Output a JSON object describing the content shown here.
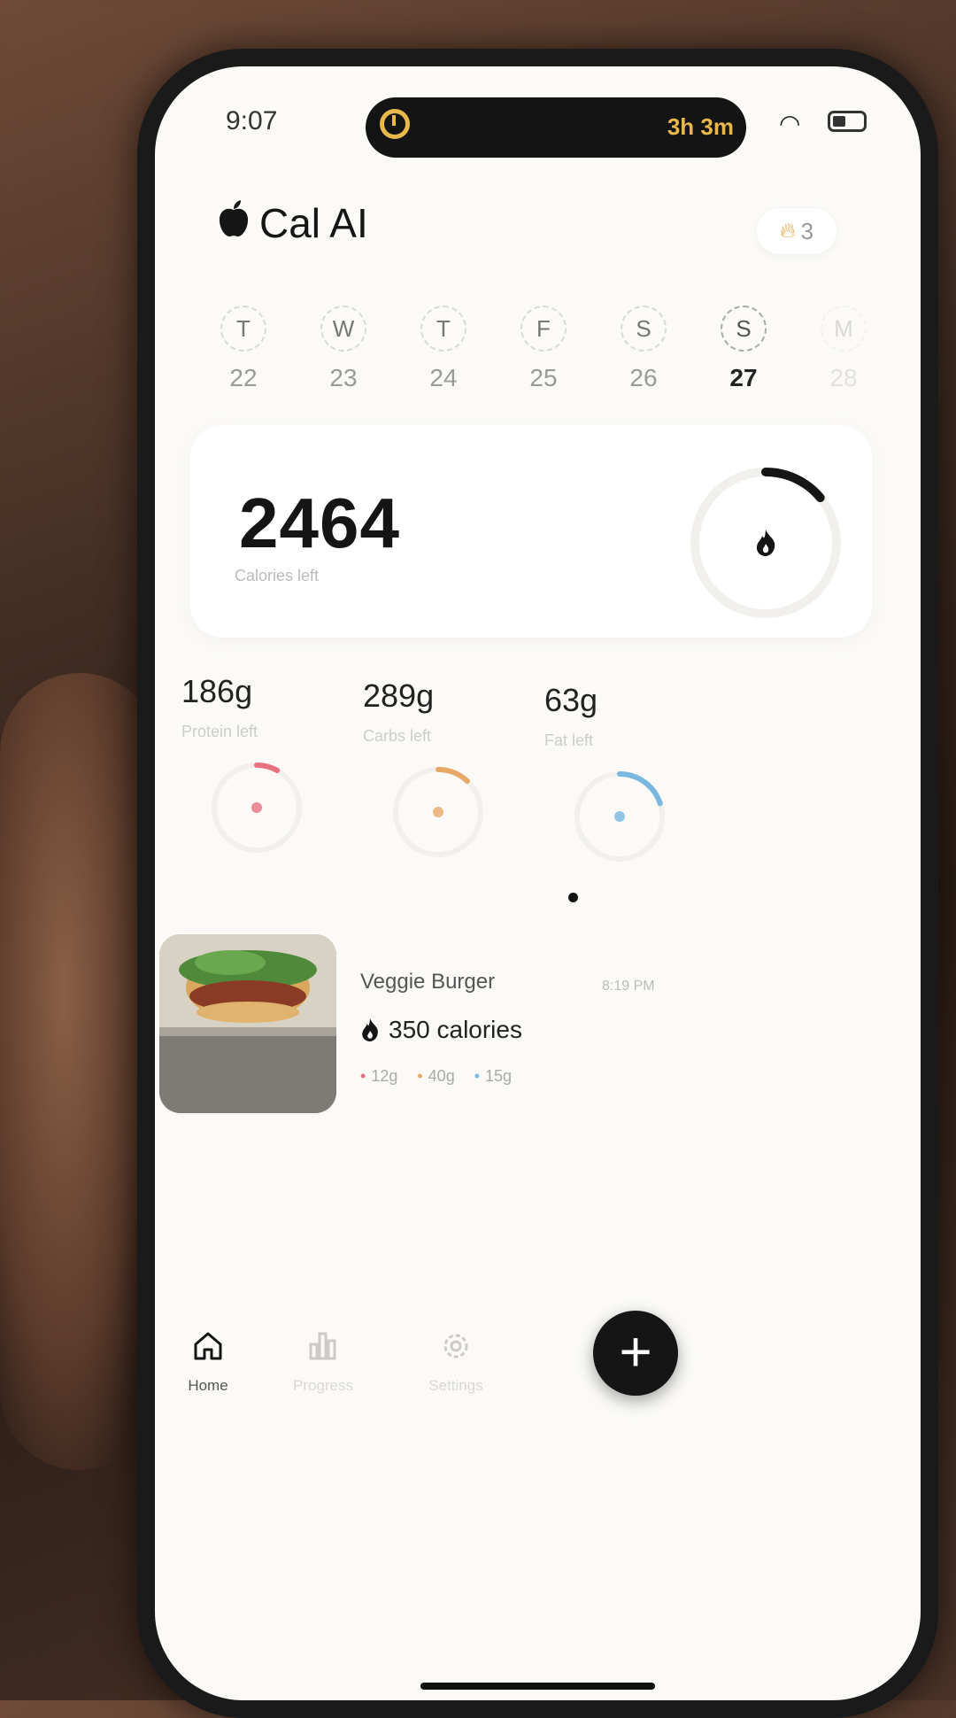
{
  "status_bar": {
    "time": "9:07",
    "island_timer": "3h 3m"
  },
  "header": {
    "app_title": "Cal AI",
    "streak_count": "3"
  },
  "week": [
    {
      "letter": "T",
      "num": "22",
      "state": "normal"
    },
    {
      "letter": "W",
      "num": "23",
      "state": "normal"
    },
    {
      "letter": "T",
      "num": "24",
      "state": "normal"
    },
    {
      "letter": "F",
      "num": "25",
      "state": "normal"
    },
    {
      "letter": "S",
      "num": "26",
      "state": "normal"
    },
    {
      "letter": "S",
      "num": "27",
      "state": "active"
    },
    {
      "letter": "M",
      "num": "28",
      "state": "faded"
    }
  ],
  "calories": {
    "value": "2464",
    "label": "Calories left",
    "progress": 0.14
  },
  "macros": [
    {
      "value": "186g",
      "label": "Protein left",
      "color": "#e8717f",
      "progress": 0.08
    },
    {
      "value": "289g",
      "label": "Carbs left",
      "color": "#e8a866",
      "progress": 0.12
    },
    {
      "value": "63g",
      "label": "Fat left",
      "color": "#7ab8e0",
      "progress": 0.2
    }
  ],
  "meal": {
    "name": "Veggie Burger",
    "time": "8:19 PM",
    "calories": "350 calories",
    "protein": "12g",
    "carbs": "40g",
    "fat": "15g"
  },
  "nav": {
    "home": "Home",
    "progress": "Progress",
    "settings": "Settings"
  },
  "fab_label": "+"
}
